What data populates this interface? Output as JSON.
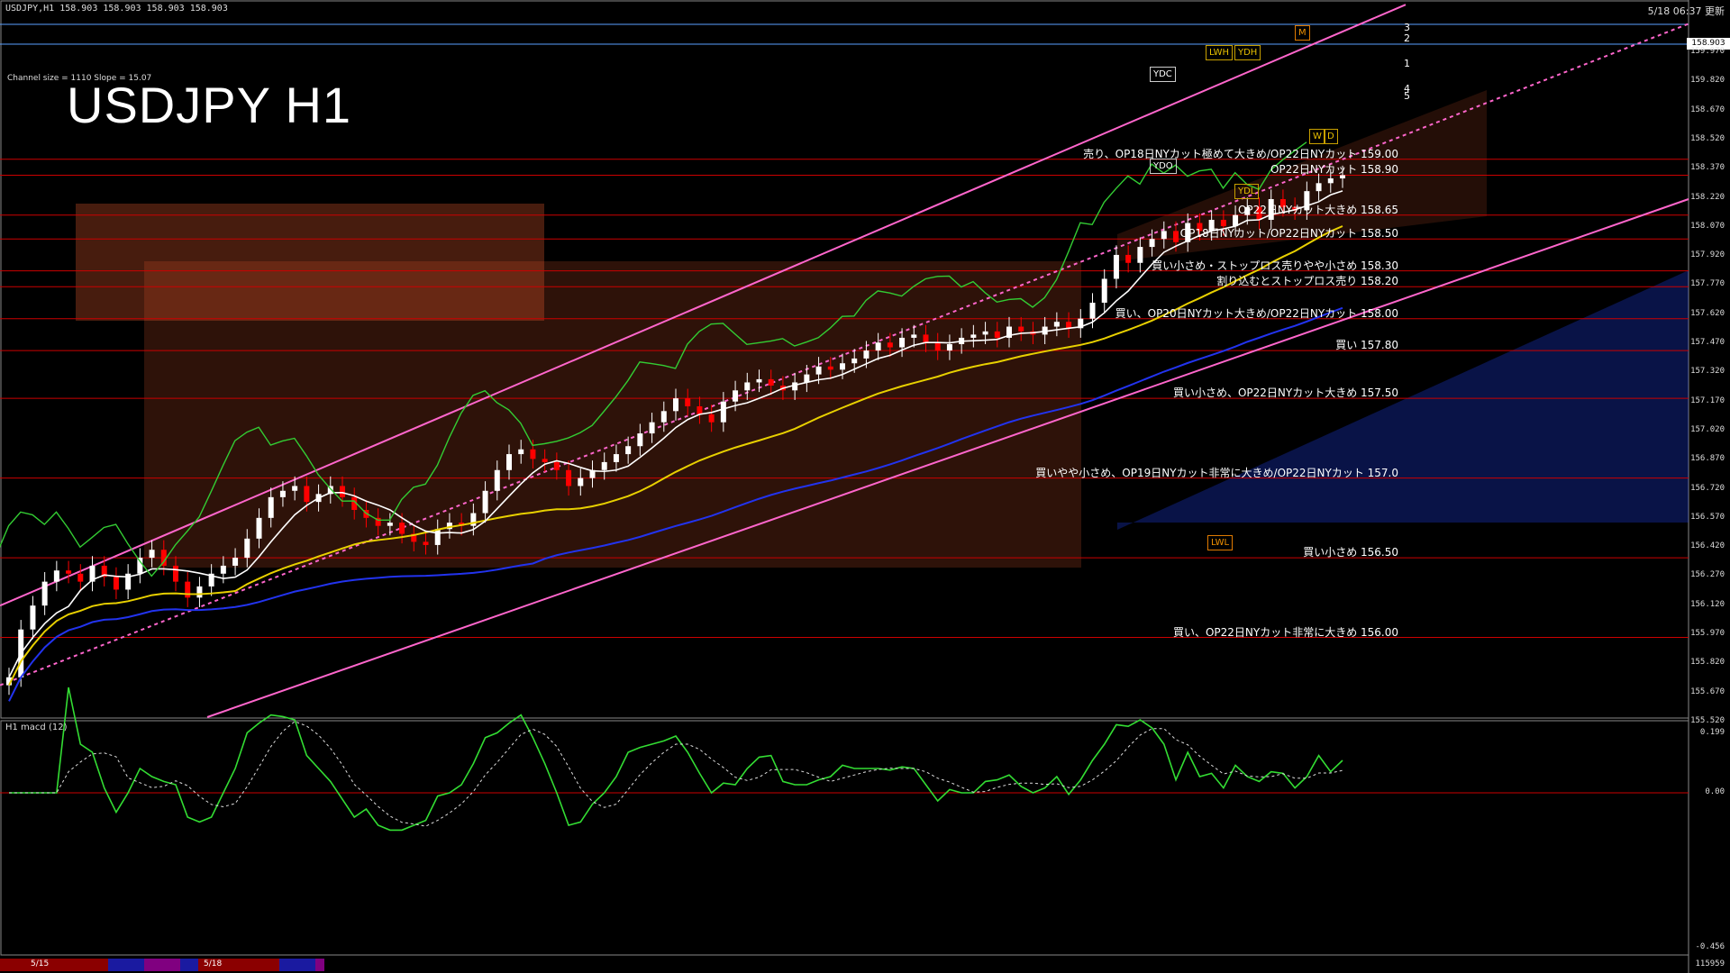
{
  "window": {
    "symbol_info": "USDJPY,H1  158.903 158.903 158.903 158.903",
    "datetime": "5/18 06:37 更新",
    "title": "USDJPY H1",
    "channel_info": "Channel size = 1110 Slope = 15.07",
    "macd_label": "H1  macd (12)",
    "current_price": "158.903",
    "volume_label": "115959"
  },
  "colors": {
    "background": "#000000",
    "bull_candle": "#ffffff",
    "bear_candle": "#ff0000",
    "level_line": "#cc0000",
    "channel": "#ff66cc",
    "macd_main": "#33dd33",
    "macd_signal": "#dddddd",
    "cloud_bear": "#ff6633",
    "cloud_bull": "#2244ff"
  },
  "price_axis": {
    "min": 155.5,
    "max": 159.92,
    "ticks": [
      "159.970",
      "159.820",
      "158.670",
      "158.520",
      "158.370",
      "158.220",
      "158.070",
      "157.920",
      "157.770",
      "157.620",
      "157.470",
      "157.320",
      "157.170",
      "157.020",
      "156.870",
      "156.720",
      "156.570",
      "156.420",
      "156.270",
      "156.120",
      "155.970",
      "155.820",
      "155.670",
      "155.520"
    ]
  },
  "macd_axis": {
    "top": "0.199",
    "zero": "0.00",
    "bottom": "-0.456"
  },
  "level_lines": [
    {
      "price": 159.0,
      "label": "売り、OP18日NYカット極めて大きめ/OP22日NYカット 159.00"
    },
    {
      "price": 158.9,
      "label": "OP22日NYカット 158.90"
    },
    {
      "price": 158.65,
      "label": "OP22日NYカット大きめ 158.65"
    },
    {
      "price": 158.5,
      "label": "OP18日NYカット/OP22日NYカット 158.50"
    },
    {
      "price": 158.3,
      "label": "買い小さめ・ストップロス売りやや小さめ 158.30"
    },
    {
      "price": 158.2,
      "label": "割り込むとストップロス売り 158.20"
    },
    {
      "price": 158.0,
      "label": "買い、OP20日NYカット大きめ/OP22日NYカット 158.00"
    },
    {
      "price": 157.8,
      "label": "買い 157.80"
    },
    {
      "price": 157.5,
      "label": "買い小さめ、OP22日NYカット大きめ 157.50"
    },
    {
      "price": 157.0,
      "label": "買いやや小さめ、OP19日NYカット非常に大きめ/OP22日NYカット 157.0"
    },
    {
      "price": 156.5,
      "label": "買い小さめ 156.50"
    },
    {
      "price": 156.0,
      "label": "買い、OP22日NYカット非常に大きめ 156.00"
    }
  ],
  "tags": {
    "lwh": "LWH",
    "ydh": "YDH",
    "ydc": "YDC",
    "ydo": "YDO",
    "ydl": "YDL",
    "lwl": "LWL",
    "w": "W",
    "d": "D",
    "m": "M"
  },
  "channel_numbers": [
    "3",
    "2",
    "1",
    "4",
    "5"
  ],
  "date_labels": [
    "5/15",
    "5/18"
  ],
  "chart_data": {
    "type": "line",
    "title": "USDJPY H1",
    "ylabel": "",
    "ylim": [
      155.5,
      159.92
    ],
    "series": [
      {
        "name": "",
        "values": [
          155.75,
          156.05,
          156.2,
          156.35,
          156.42,
          156.4,
          156.35,
          156.45,
          156.38,
          156.3,
          156.4,
          156.5,
          156.55,
          156.45,
          156.35,
          156.25,
          156.32,
          156.4,
          156.45,
          156.5,
          156.62,
          156.75,
          156.88,
          156.92,
          156.95,
          156.85,
          156.9,
          156.95,
          156.88,
          156.8,
          156.75,
          156.7,
          156.72,
          156.65,
          156.6,
          156.58,
          156.68,
          156.72,
          156.7,
          156.78,
          156.92,
          157.05,
          157.15,
          157.18,
          157.12,
          157.1,
          157.05,
          156.95,
          157.0,
          157.05,
          157.1,
          157.15,
          157.2,
          157.28,
          157.35,
          157.42,
          157.5,
          157.45,
          157.4,
          157.35,
          157.48,
          157.55,
          157.6,
          157.62,
          157.58,
          157.55,
          157.6,
          157.65,
          157.7,
          157.68,
          157.72,
          157.75,
          157.8,
          157.85,
          157.82,
          157.88,
          157.9,
          157.85,
          157.8,
          157.84,
          157.88,
          157.9,
          157.92,
          157.88,
          157.95,
          157.92,
          157.9,
          157.95,
          157.98,
          157.94,
          158.0,
          158.1,
          158.25,
          158.4,
          158.35,
          158.45,
          158.5,
          158.55,
          158.48,
          158.6,
          158.55,
          158.62,
          158.58,
          158.65,
          158.7,
          158.62,
          158.75,
          158.7,
          158.68,
          158.8,
          158.85,
          158.88,
          158.9
        ]
      }
    ]
  }
}
